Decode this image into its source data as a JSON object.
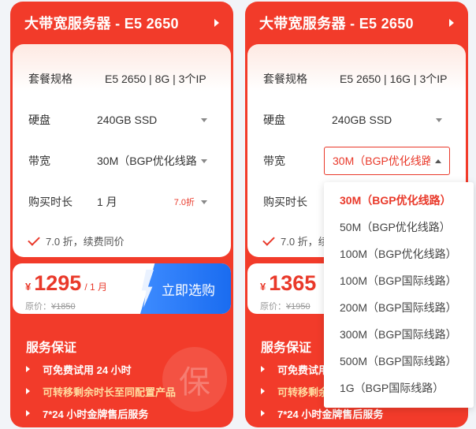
{
  "cards": [
    {
      "title": "大带宽服务器 - E5 2650",
      "spec_label": "套餐规格",
      "spec_value": "E5 2650 | 8G | 3个IP",
      "disk_label": "硬盘",
      "disk_value": "240GB SSD",
      "bandwidth_label": "带宽",
      "bandwidth_value": "30M（BGP优化线路）",
      "duration_label": "购买时长",
      "duration_value": "1 月",
      "duration_discount": "7.0折",
      "note": "7.0 折，续费同价",
      "currency": "¥",
      "price": "1295",
      "per": "/ 1 月",
      "orig_label": "原价：",
      "orig_price": "¥1850",
      "buy_label": "立即选购",
      "service_title": "服务保证",
      "service_items": [
        "可免费试用 24 小时",
        "可转移剩余时长至同配置产品",
        "7*24 小时金牌售后服务"
      ],
      "seal": "保"
    },
    {
      "title": "大带宽服务器 - E5 2650",
      "spec_label": "套餐规格",
      "spec_value": "E5 2650 | 16G | 3个IP",
      "disk_label": "硬盘",
      "disk_value": "240GB SSD",
      "bandwidth_label": "带宽",
      "bandwidth_value": "30M（BGP优化线路）",
      "duration_label": "购买时长",
      "note": "7.0 折，续费同价",
      "currency": "¥",
      "price": "1365",
      "orig_label": "原价：",
      "orig_price": "¥1950",
      "service_title": "服务保证",
      "service_items": [
        "可免费试用",
        "可转移剩余",
        "7*24 小时金牌售后服务"
      ]
    }
  ],
  "dropdown": {
    "options": [
      "30M（BGP优化线路）",
      "50M（BGP优化线路）",
      "100M（BGP优化线路）",
      "100M（BGP国际线路）",
      "200M（BGP国际线路）",
      "300M（BGP国际线路）",
      "500M（BGP国际线路）",
      "1G（BGP国际线路）"
    ],
    "selected_index": 0
  },
  "colors": {
    "brand_red": "#f23b2a",
    "accent_blue": "#1a6cf0",
    "highlight_yellow": "#ffdca0"
  }
}
